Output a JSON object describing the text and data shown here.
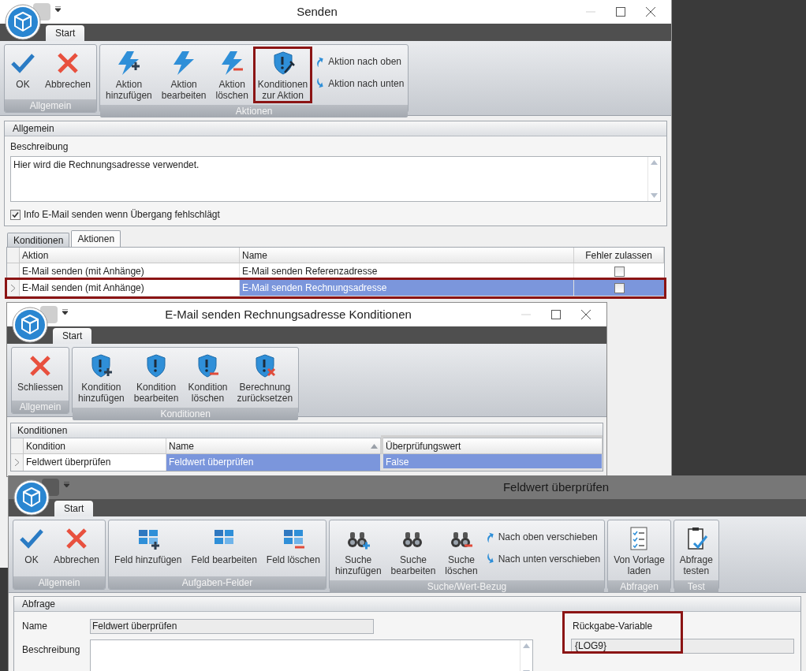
{
  "windows": [
    {
      "title": "Senden",
      "focused": true,
      "show_controls": true,
      "tab": "Start",
      "ribbon": [
        {
          "label": "Allgemein",
          "buttons": [
            {
              "label": "OK",
              "highlighted": false
            },
            {
              "label": "Abbrechen",
              "highlighted": false
            }
          ]
        },
        {
          "label": "Aktionen",
          "buttons": [
            {
              "label": "Aktion\nhinzufügen",
              "highlighted": false
            },
            {
              "label": "Aktion\nbearbeiten",
              "highlighted": false
            },
            {
              "label": "Aktion\nlöschen",
              "highlighted": false
            },
            {
              "label": "Konditionen\nzur Aktion",
              "highlighted": true
            }
          ],
          "small_buttons": [
            {
              "label": "Aktion nach oben"
            },
            {
              "label": "Aktion nach unten"
            }
          ]
        }
      ],
      "general": {
        "header": "Allgemein",
        "description_label": "Beschreibung",
        "description": "Hier wird die Rechnungsadresse verwendet.",
        "checkbox": {
          "label": "Info E-Mail senden wenn Übergang fehlschlägt",
          "checked": true
        }
      },
      "tabs": [
        {
          "label": "Konditionen",
          "selected": false
        },
        {
          "label": "Aktionen",
          "selected": true
        }
      ],
      "table": {
        "columns": [
          "Aktion",
          "Name",
          "Fehler zulassen"
        ],
        "rows": [
          {
            "aktion": "E-Mail senden (mit Anhänge)",
            "name": "E-Mail senden Referenzadresse",
            "fehler_zulassen": false,
            "selected": false,
            "highlighted": false
          },
          {
            "aktion": "E-Mail senden (mit Anhänge)",
            "name": "E-Mail senden Rechnungsadresse",
            "fehler_zulassen": false,
            "selected": true,
            "highlighted": true
          }
        ]
      }
    },
    {
      "title": "E-Mail senden Rechnungsadresse Konditionen",
      "focused": true,
      "show_controls": true,
      "tab": "Start",
      "ribbon": [
        {
          "label": "Allgemein",
          "buttons": [
            {
              "label": "Schliessen",
              "highlighted": false
            }
          ]
        },
        {
          "label": "Konditionen",
          "buttons": [
            {
              "label": "Kondition\nhinzufügen",
              "highlighted": false
            },
            {
              "label": "Kondition\nbearbeiten",
              "highlighted": false
            },
            {
              "label": "Kondition\nlöschen",
              "highlighted": false
            },
            {
              "label": "Berechnung\nzurücksetzen",
              "highlighted": false
            }
          ]
        }
      ],
      "panel": {
        "header": "Konditionen",
        "columns": [
          {
            "label": "Kondition",
            "sorted": false,
            "highlighted": false
          },
          {
            "label": "Name",
            "sorted": true,
            "highlighted": false
          },
          {
            "label": "Überprüfungswert",
            "sorted": false,
            "highlighted": true
          }
        ],
        "rows": [
          {
            "cells": [
              "Feldwert überprüfen",
              "Feldwert überprüfen",
              "False"
            ],
            "selected": true
          }
        ]
      }
    },
    {
      "title": "Feldwert überprüfen",
      "focused": false,
      "show_controls": false,
      "tab": "Start",
      "ribbon": [
        {
          "label": "Allgemein",
          "buttons": [
            {
              "label": "OK",
              "highlighted": false
            },
            {
              "label": "Abbrechen",
              "highlighted": false
            }
          ]
        },
        {
          "label": "Aufgaben-Felder",
          "buttons": [
            {
              "label": "Feld hinzufügen",
              "highlighted": false
            },
            {
              "label": "Feld bearbeiten",
              "highlighted": false
            },
            {
              "label": "Feld löschen",
              "highlighted": false
            }
          ]
        },
        {
          "label": "Suche/Wert-Bezug",
          "buttons": [
            {
              "label": "Suche\nhinzufügen",
              "highlighted": false
            },
            {
              "label": "Suche\nbearbeiten",
              "highlighted": false
            },
            {
              "label": "Suche\nlöschen",
              "highlighted": false
            }
          ],
          "small_buttons": [
            {
              "label": "Nach oben verschieben"
            },
            {
              "label": "Nach unten verschieben"
            }
          ]
        },
        {
          "label": "Abfragen",
          "buttons": [
            {
              "label": "Von Vorlage\nladen",
              "highlighted": false
            }
          ]
        },
        {
          "label": "Test",
          "buttons": [
            {
              "label": "Abfrage\ntesten",
              "highlighted": false
            }
          ]
        }
      ],
      "query": {
        "header": "Abfrage",
        "name_label": "Name",
        "name": "Feldwert überprüfen",
        "description_label": "Beschreibung",
        "return_label": "Rückgabe-Variable",
        "return_value": "{LOG9}",
        "return_highlighted": true
      }
    }
  ]
}
